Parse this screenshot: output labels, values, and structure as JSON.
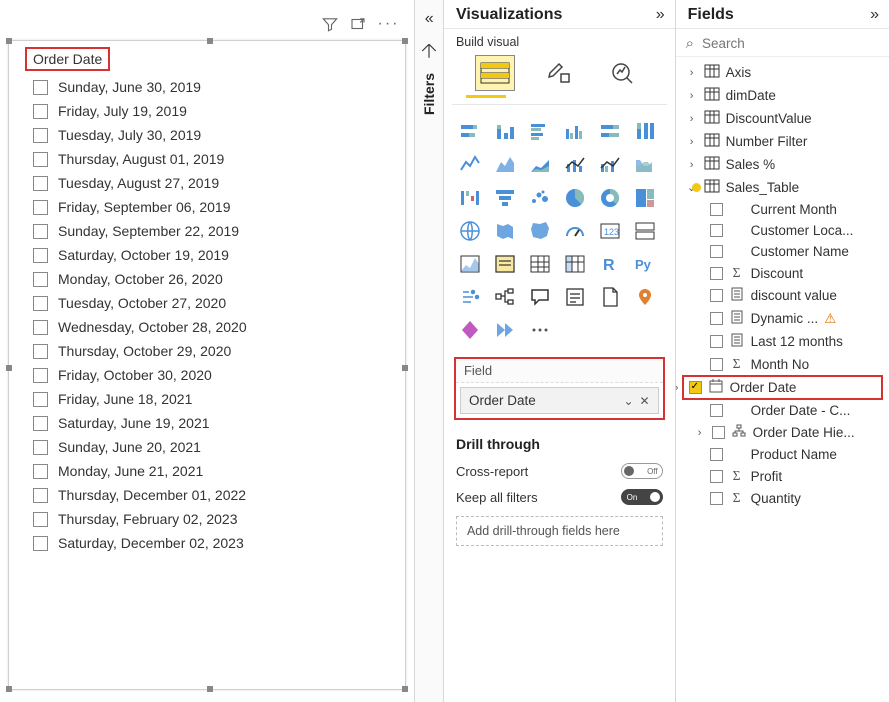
{
  "slicer": {
    "title": "Order Date",
    "items": [
      "Sunday, June 30, 2019",
      "Friday, July 19, 2019",
      "Tuesday, July 30, 2019",
      "Thursday, August 01, 2019",
      "Tuesday, August 27, 2019",
      "Friday, September 06, 2019",
      "Sunday, September 22, 2019",
      "Saturday, October 19, 2019",
      "Monday, October 26, 2020",
      "Tuesday, October 27, 2020",
      "Wednesday, October 28, 2020",
      "Thursday, October 29, 2020",
      "Friday, October 30, 2020",
      "Friday, June 18, 2021",
      "Saturday, June 19, 2021",
      "Sunday, June 20, 2021",
      "Monday, June 21, 2021",
      "Thursday, December 01, 2022",
      "Thursday, February 02, 2023",
      "Saturday, December 02, 2023"
    ]
  },
  "filters_label": "Filters",
  "visualizations": {
    "header": "Visualizations",
    "build_visual_label": "Build visual",
    "field_well_label": "Field",
    "field_well_value": "Order Date",
    "drill_header": "Drill through",
    "cross_report_label": "Cross-report",
    "cross_report_state": "Off",
    "keep_filters_label": "Keep all filters",
    "keep_filters_state": "On",
    "drill_drop_placeholder": "Add drill-through fields here"
  },
  "fields": {
    "header": "Fields",
    "search_placeholder": "Search",
    "tables_collapsed": [
      "Axis",
      "dimDate",
      "DiscountValue",
      "Number Filter",
      "Sales %"
    ],
    "table_expanded": "Sales_Table",
    "expanded_fields": [
      {
        "name": "Current Month",
        "icon": "",
        "checked": false
      },
      {
        "name": "Customer Loca...",
        "icon": "",
        "checked": false
      },
      {
        "name": "Customer Name",
        "icon": "",
        "checked": false
      },
      {
        "name": "Discount",
        "icon": "Σ",
        "checked": false
      },
      {
        "name": "discount value",
        "icon": "calc",
        "checked": false
      },
      {
        "name": "Dynamic ...",
        "icon": "calc",
        "checked": false,
        "warn": true
      },
      {
        "name": "Last 12 months",
        "icon": "calc",
        "checked": false
      },
      {
        "name": "Month No",
        "icon": "Σ",
        "checked": false
      },
      {
        "name": "Order Date",
        "icon": "date",
        "checked": true,
        "highlight": true,
        "chev": true
      },
      {
        "name": "Order Date - C...",
        "icon": "",
        "checked": false
      },
      {
        "name": "Order Date Hie...",
        "icon": "hier",
        "checked": false,
        "chev": true
      },
      {
        "name": "Product Name",
        "icon": "",
        "checked": false
      },
      {
        "name": "Profit",
        "icon": "Σ",
        "checked": false
      },
      {
        "name": "Quantity",
        "icon": "Σ",
        "checked": false
      }
    ]
  }
}
